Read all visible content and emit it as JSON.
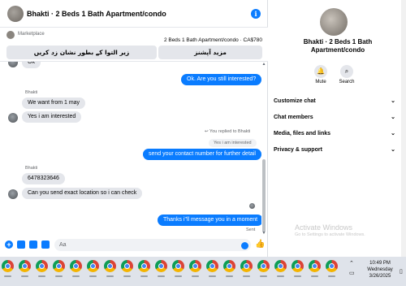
{
  "header": {
    "title": "Bhakti · 2 Beds 1 Bath Apartment/condo",
    "info_glyph": "i"
  },
  "marketplace": {
    "label": "Marketplace",
    "listing": "2 Beds 1 Bath Apartment/condo · CA$780",
    "btn_left": "زیر التوا کے بطور نشان زد کریں",
    "btn_right": "مزید آپشنز"
  },
  "messages": {
    "top_partial": "Ok",
    "out_1": "Ok. Are you still interested?",
    "sender_1": "Bhakti",
    "in_1": "We want from 1 may",
    "in_2": "Yes i am interested",
    "reply_note": "You replied to Bhakti",
    "reply_quote": "Yes i am interested",
    "out_2": "send your contact number for further detail",
    "sender_2": "Bhakti",
    "in_3": "6478323646",
    "in_4": "Can you send exact location so i can check",
    "out_3": "Thanks i\"ll message you in a moment",
    "sent_label": "Sent"
  },
  "composer": {
    "placeholder": "Aa"
  },
  "side": {
    "name": "Bhakti · 2 Beds 1 Bath Apartment/condo",
    "mute_label": "Mute",
    "search_label": "Search",
    "sections": [
      "Customize chat",
      "Chat members",
      "Media, files and links",
      "Privacy & support"
    ]
  },
  "watermark": {
    "title": "Activate Windows",
    "subtitle": "Go to Settings to activate Windows."
  },
  "taskbar": {
    "time": "10:49 PM",
    "day": "Wednesday",
    "date": "3/26/2025"
  },
  "colors": {
    "accent": "#0a7cff",
    "bubble_in": "#e4e6eb",
    "taskbar": "#dfe3ea"
  }
}
